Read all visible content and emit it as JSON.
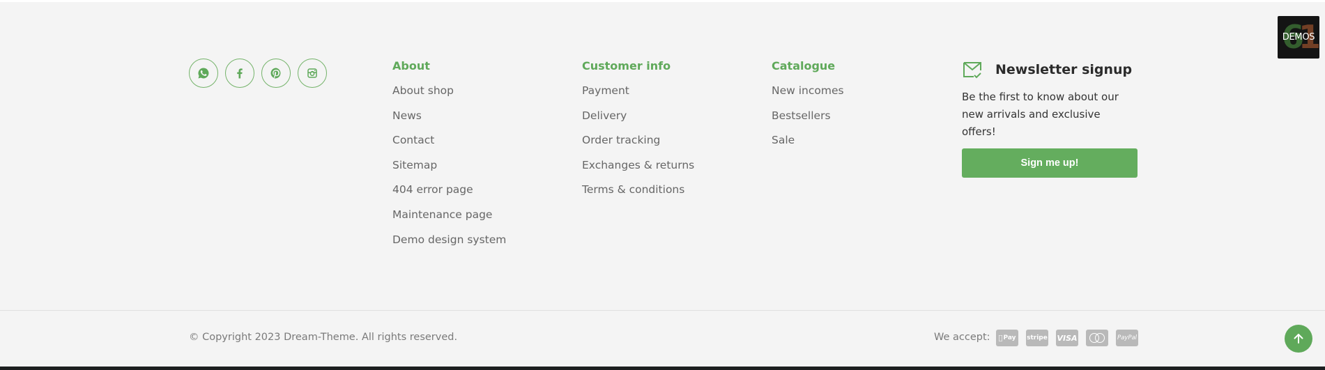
{
  "social": [
    {
      "icon": "whatsapp-icon"
    },
    {
      "icon": "facebook-icon"
    },
    {
      "icon": "pinterest-icon"
    },
    {
      "icon": "instagram-icon"
    }
  ],
  "about": {
    "title": "About",
    "links": [
      "About shop",
      "News",
      "Contact",
      "Sitemap",
      "404 error page",
      "Maintenance page",
      "Demo design system"
    ]
  },
  "customer_info": {
    "title": "Customer info",
    "links": [
      "Payment",
      "Delivery",
      "Order tracking",
      "Exchanges & returns",
      "Terms & conditions"
    ]
  },
  "catalogue": {
    "title": "Catalogue",
    "links": [
      "New incomes",
      "Bestsellers",
      "Sale"
    ]
  },
  "newsletter": {
    "icon": "mail-check-icon",
    "title": "Newsletter signup",
    "text": "Be the first to know about our new arrivals and exclusive offers!",
    "button": "Sign me up!"
  },
  "footer_bottom": {
    "copyright": "© Copyright 2023 Dream-Theme. All rights reserved.",
    "we_accept": "We accept:",
    "payments": [
      {
        "icon": "apple-pay-icon",
        "label": "Pay"
      },
      {
        "icon": "stripe-icon",
        "label": "stripe"
      },
      {
        "icon": "visa-icon",
        "label": "VISA"
      },
      {
        "icon": "mastercard-icon",
        "label": ""
      },
      {
        "icon": "paypal-icon",
        "label": "PayPal"
      }
    ]
  },
  "demos_badge": {
    "number": "61",
    "label": "DEMOS"
  },
  "scroll_top": {
    "icon": "arrow-up-icon"
  },
  "colors": {
    "accent": "#5fa95a",
    "background": "#f4f4f4",
    "payment_icon": "#b9b9b9"
  }
}
